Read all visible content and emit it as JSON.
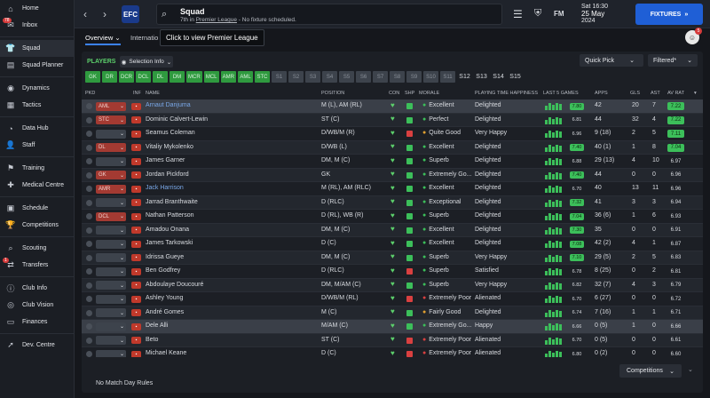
{
  "sidebar": {
    "items": [
      {
        "label": "Home",
        "icon": "home-icon",
        "glyph": "⌂"
      },
      {
        "label": "Inbox",
        "icon": "inbox-icon",
        "glyph": "✉",
        "badge": "78"
      },
      {
        "label": "Squad",
        "icon": "squad-icon",
        "glyph": "👕",
        "active": true
      },
      {
        "label": "Squad Planner",
        "icon": "squad-planner-icon",
        "glyph": "▤"
      },
      {
        "label": "Dynamics",
        "icon": "dynamics-icon",
        "glyph": "◉"
      },
      {
        "label": "Tactics",
        "icon": "tactics-icon",
        "glyph": "▦"
      },
      {
        "label": "Data Hub",
        "icon": "data-hub-icon",
        "glyph": "◔"
      },
      {
        "label": "Staff",
        "icon": "staff-icon",
        "glyph": "👤"
      },
      {
        "label": "Training",
        "icon": "training-icon",
        "glyph": "⚑"
      },
      {
        "label": "Medical Centre",
        "icon": "medical-centre-icon",
        "glyph": "✚"
      },
      {
        "label": "Schedule",
        "icon": "schedule-icon",
        "glyph": "▣"
      },
      {
        "label": "Competitions",
        "icon": "competitions-icon",
        "glyph": "🏆"
      },
      {
        "label": "Scouting",
        "icon": "scouting-icon",
        "glyph": "⌕"
      },
      {
        "label": "Transfers",
        "icon": "transfers-icon",
        "glyph": "⇄",
        "badge": "1"
      },
      {
        "label": "Club Info",
        "icon": "club-info-icon",
        "glyph": "ⓘ"
      },
      {
        "label": "Club Vision",
        "icon": "club-vision-icon",
        "glyph": "◎"
      },
      {
        "label": "Finances",
        "icon": "finances-icon",
        "glyph": "▭"
      },
      {
        "label": "Dev. Centre",
        "icon": "dev-centre-icon",
        "glyph": "➚"
      }
    ]
  },
  "topbar": {
    "title": "Squad",
    "subtitle_prefix": "7th in ",
    "subtitle_link": "Premier League",
    "subtitle_suffix": " - No fixture scheduled.",
    "crest_text": "EFC",
    "date_time": "Sat 16:30",
    "date_day": "25 May",
    "date_year": "2024",
    "fm_label": "FM",
    "fixtures_label": "FIXTURES"
  },
  "subtabs": {
    "overview": "Overview",
    "international": "Internatio",
    "tooltip": "Click to view Premier League"
  },
  "avatar_badge": "5",
  "panel": {
    "players_label": "PLAYERS",
    "selection_info": "Selection Info",
    "quick_pick": "Quick Pick",
    "filtered": "Filtered*"
  },
  "position_filters": {
    "on": [
      "GK",
      "DR",
      "DCR",
      "DCL",
      "DL",
      "DM",
      "MCR",
      "MCL",
      "AMR",
      "AML",
      "STC"
    ],
    "dim": [
      "S1",
      "S2",
      "S3",
      "S4",
      "S5",
      "S6",
      "S7",
      "S8",
      "S9",
      "S10",
      "S11"
    ],
    "plain": [
      "S12",
      "S13",
      "S14",
      "S15"
    ]
  },
  "columns": {
    "pkd": "PKD",
    "inf": "INF",
    "name": "NAME",
    "position": "POSITION",
    "con": "CON",
    "shp": "SHP",
    "morale": "MORALE",
    "pth": "PLAYING TIME HAPPINESS",
    "last5": "LAST 5 GAMES",
    "apps": "APPS",
    "gls": "GLS",
    "ast": "AST",
    "avr": "AV RAT"
  },
  "players": [
    {
      "pos": "AML",
      "name": "Arnaut Danjuma",
      "link": true,
      "position": "M (L), AM (RL)",
      "morale": "Excellent",
      "pt": "Delighted",
      "last": "7.80",
      "apps": "42",
      "gls": "20",
      "ast": "7",
      "avr": "7.22",
      "hl": true
    },
    {
      "pos": "STC",
      "name": "Dominic Calvert-Lewin",
      "position": "ST (C)",
      "morale": "Perfect",
      "pt": "Delighted",
      "last": "6.81",
      "apps": "44",
      "gls": "32",
      "ast": "4",
      "avr": "7.22"
    },
    {
      "pos": "",
      "name": "Seamus Coleman",
      "position": "D/WB/M (R)",
      "morale": "Quite Good",
      "pt": "Very Happy",
      "last": "6.96",
      "apps": "9 (18)",
      "gls": "2",
      "ast": "5",
      "avr": "7.11"
    },
    {
      "pos": "DL",
      "name": "Vitaliy Mykolenko",
      "position": "D/WB (L)",
      "morale": "Excellent",
      "pt": "Delighted",
      "last": "7.40",
      "apps": "40 (1)",
      "gls": "1",
      "ast": "8",
      "avr": "7.04"
    },
    {
      "pos": "",
      "name": "James Garner",
      "position": "DM, M (C)",
      "morale": "Superb",
      "pt": "Delighted",
      "last": "6.88",
      "apps": "29 (13)",
      "gls": "4",
      "ast": "10",
      "avr": "6.97"
    },
    {
      "pos": "GK",
      "name": "Jordan Pickford",
      "position": "GK",
      "morale": "Extremely Go...",
      "pt": "Delighted",
      "last": "7.40",
      "apps": "44",
      "gls": "0",
      "ast": "0",
      "avr": "6.96"
    },
    {
      "pos": "AMR",
      "name": "Jack Harrison",
      "link": true,
      "position": "M (RL), AM (RLC)",
      "morale": "Excellent",
      "pt": "Delighted",
      "last": "6.70",
      "apps": "40",
      "gls": "13",
      "ast": "11",
      "avr": "6.96"
    },
    {
      "pos": "",
      "name": "Jarrad Branthwaite",
      "position": "D (RLC)",
      "morale": "Exceptional",
      "pt": "Delighted",
      "last": "7.32",
      "apps": "41",
      "gls": "3",
      "ast": "3",
      "avr": "6.94"
    },
    {
      "pos": "DCL",
      "name": "Nathan Patterson",
      "position": "D (RL), WB (R)",
      "morale": "Superb",
      "pt": "Delighted",
      "last": "7.04",
      "apps": "36 (6)",
      "gls": "1",
      "ast": "6",
      "avr": "6.93"
    },
    {
      "pos": "",
      "name": "Amadou Onana",
      "position": "DM, M (C)",
      "morale": "Excellent",
      "pt": "Delighted",
      "last": "7.30",
      "apps": "35",
      "gls": "0",
      "ast": "0",
      "avr": "6.91"
    },
    {
      "pos": "",
      "name": "James Tarkowski",
      "position": "D (C)",
      "morale": "Excellent",
      "pt": "Delighted",
      "last": "7.08",
      "apps": "42 (2)",
      "gls": "4",
      "ast": "1",
      "avr": "6.87"
    },
    {
      "pos": "",
      "name": "Idrissa Gueye",
      "position": "DM, M (C)",
      "morale": "Superb",
      "pt": "Very Happy",
      "last": "7.10",
      "apps": "29 (5)",
      "gls": "2",
      "ast": "5",
      "avr": "6.83"
    },
    {
      "pos": "",
      "name": "Ben Godfrey",
      "position": "D (RLC)",
      "morale": "Superb",
      "pt": "Satisfied",
      "last": "6.78",
      "apps": "8 (25)",
      "gls": "0",
      "ast": "2",
      "avr": "6.81"
    },
    {
      "pos": "",
      "name": "Abdoulaye Doucouré",
      "position": "DM, M/AM (C)",
      "morale": "Superb",
      "pt": "Very Happy",
      "last": "6.82",
      "apps": "32 (7)",
      "gls": "4",
      "ast": "3",
      "avr": "6.79"
    },
    {
      "pos": "",
      "name": "Ashley Young",
      "position": "D/WB/M (RL)",
      "morale": "Extremely Poor",
      "pt": "Alienated",
      "last": "6.70",
      "apps": "6 (27)",
      "gls": "0",
      "ast": "0",
      "avr": "6.72"
    },
    {
      "pos": "",
      "name": "André Gomes",
      "position": "M (C)",
      "morale": "Fairly Good",
      "pt": "Delighted",
      "last": "6.74",
      "apps": "7 (16)",
      "gls": "1",
      "ast": "1",
      "avr": "6.71"
    },
    {
      "pos": "",
      "name": "Dele Alli",
      "position": "M/AM (C)",
      "morale": "Extremely Go...",
      "pt": "Happy",
      "last": "6.66",
      "apps": "0 (5)",
      "gls": "1",
      "ast": "0",
      "avr": "6.66",
      "hl": true
    },
    {
      "pos": "",
      "name": "Beto",
      "position": "ST (C)",
      "morale": "Extremely Poor",
      "pt": "Alienated",
      "last": "6.70",
      "apps": "0 (5)",
      "gls": "0",
      "ast": "0",
      "avr": "6.61"
    },
    {
      "pos": "",
      "name": "Michael Keane",
      "position": "D (C)",
      "morale": "Extremely Poor",
      "pt": "Alienated",
      "last": "6.80",
      "apps": "0 (2)",
      "gls": "0",
      "ast": "0",
      "avr": "6.60"
    }
  ],
  "footer": {
    "match_day_rules": "No Match Day Rules",
    "competitions": "Competitions"
  },
  "colors": {
    "accent_blue": "#1f5fd6",
    "green": "#2f9a3f",
    "red_pos": "#c0392b",
    "link": "#7aa8e8"
  }
}
